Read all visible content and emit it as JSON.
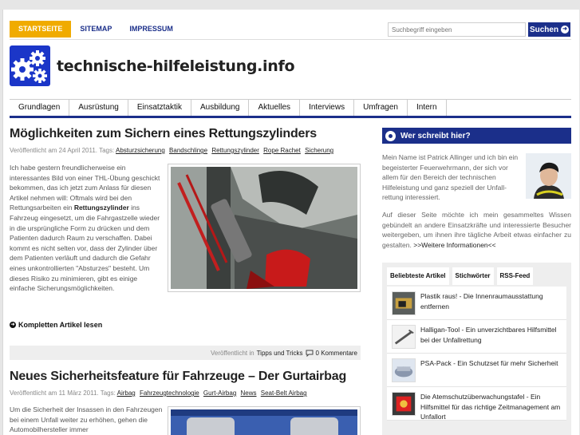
{
  "topnav": [
    "STARTSEITE",
    "SITEMAP",
    "IMPRESSUM"
  ],
  "search": {
    "placeholder": "Suchbegriff eingeben",
    "button": "Suchen"
  },
  "site_title": "technische-hilfeleistung.info",
  "mainnav": [
    "Grundlagen",
    "Ausrüstung",
    "Einsatztaktik",
    "Ausbildung",
    "Aktuelles",
    "Interviews",
    "Umfragen",
    "Intern"
  ],
  "post1": {
    "title": "Möglichkeiten zum Sichern eines Rettungszylinders",
    "meta_prefix": "Veröffentlicht am 24 April 2011. Tags:",
    "tags": [
      "Absturzsicherung",
      "Bandschlinge",
      "Rettungszylinder",
      "Rope Rachet",
      "Sicherung"
    ],
    "excerpt_a": "Ich habe gestern freundlicherweise ein interessantes Bild von einer THL-Übung geschickt bekommen, das ich jetzt zum Anlass für diesen Artikel nehmen will: Oftmals wird bei den Rettungsarbeiten ein ",
    "excerpt_bold": "Rettungszylinder",
    "excerpt_b": " ins Fahrzeug eingesetzt, um die Fahrgastzelle wieder in die ursprüngliche Form zu drücken und dem Patienten dadurch Raum zu verschaffen. Dabei kommt es nicht selten vor, dass der Zylinder über dem Patienten verläuft und dadurch die Gefahr eines unkontrollierten \"Absturzes\" besteht. Um dieses Risiko zu minimieren, gibt es einige einfache Sicherungsmöglichkeiten.",
    "readmore": "Kompletten Artikel lesen",
    "foot_prefix": "Veröffentlicht in",
    "foot_category": "Tipps und Tricks",
    "foot_comments": "0 Kommentare"
  },
  "post2": {
    "title": "Neues Sicherheitsfeature für Fahrzeuge – Der Gurtairbag",
    "meta_prefix": "Veröffentlicht am 11 März 2011. Tags:",
    "tags": [
      "Airbag",
      "Fahrzeugtechnologie",
      "Gurt-Airbag",
      "News",
      "Seat-Belt Airbag"
    ],
    "excerpt": "Um die Sicherheit der Insassen in den Fahrzeugen bei einem Unfall weiter zu erhöhen, gehen die Automobilhersteller immer"
  },
  "sidebar": {
    "title": "Wer schreibt hier?",
    "about_top": "Mein Name ist Patrick Allinger und ich bin ein begeisterter Feuerwehrmann, der sich vor allem für den Bereich der technischen Hilfeleistung und ganz speziell der Unfall-rettung interessiert.",
    "about_bottom": "Auf dieser Seite möchte ich mein gesammeltes Wissen gebündelt an andere Einsatzkräfte und interessierte Besucher weitergeben, um ihnen ihre tägliche Arbeit etwas einfacher zu gestalten.",
    "about_link": ">>Weitere Informationen<<",
    "tabs": [
      "Beliebteste Artikel",
      "Stichwörter",
      "RSS-Feed"
    ],
    "items": [
      "Plastik raus! - Die Innenraumausstattung entfernen",
      "Halligan-Tool - Ein unverzichtbares Hilfsmittel bei der Unfallrettung",
      "PSA-Pack - Ein Schutzset für mehr Sicherheit",
      "Die Atemschutzüberwachungstafel - Ein Hilfsmittel für das richtige Zeitmanagement am Unfallort"
    ]
  },
  "colors": {
    "accent": "#1b2f8a",
    "active_tab": "#f0ab00",
    "logo": "#1b36c8"
  }
}
